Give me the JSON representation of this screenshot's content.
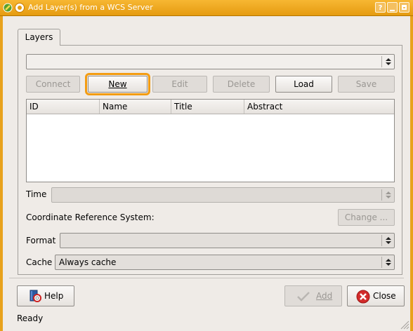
{
  "window": {
    "title": "Add Layer(s) from a WCS Server",
    "help_glyph": "?"
  },
  "tabs": [
    {
      "label": "Layers"
    }
  ],
  "server_combo": {
    "value": ""
  },
  "toolbar": {
    "connect_label": "Connect",
    "new_label": "New",
    "edit_label": "Edit",
    "delete_label": "Delete",
    "load_label": "Load",
    "save_label": "Save"
  },
  "layer_table": {
    "columns": [
      "ID",
      "Name",
      "Title",
      "Abstract"
    ],
    "rows": []
  },
  "time": {
    "label": "Time",
    "value": ""
  },
  "crs": {
    "label": "Coordinate Reference System:",
    "change_label": "Change ..."
  },
  "format": {
    "label": "Format",
    "value": ""
  },
  "cache": {
    "label": "Cache",
    "value": "Always cache"
  },
  "footer": {
    "help_label": "Help",
    "add_label": "Add",
    "close_label": "Close"
  },
  "status": {
    "text": "Ready"
  },
  "colors": {
    "titlebar": "#e59b10",
    "focus_outline": "#f39c12",
    "close_icon": "#d22b2b"
  },
  "icons": [
    "qgis-app-icon",
    "window-menu-icon",
    "help-icon",
    "minimize-icon",
    "maximize-icon",
    "help-book-icon",
    "checkmark-icon",
    "close-x-icon",
    "size-grip-icon"
  ]
}
